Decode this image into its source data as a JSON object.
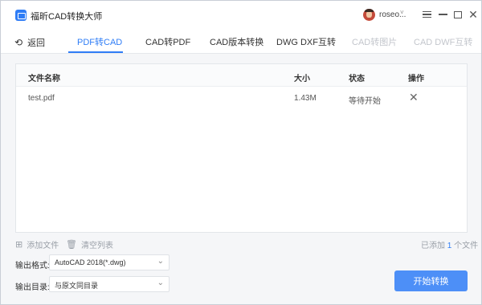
{
  "app": {
    "title": "福昕CAD转换大师",
    "username": "roseo..."
  },
  "tabs": {
    "back_label": "返回",
    "items": [
      {
        "label": "PDF转CAD",
        "state": "active"
      },
      {
        "label": "CAD转PDF",
        "state": "normal"
      },
      {
        "label": "CAD版本转换",
        "state": "normal"
      },
      {
        "label": "DWG DXF互转",
        "state": "normal"
      },
      {
        "label": "CAD转图片",
        "state": "disabled"
      },
      {
        "label": "CAD DWF互转",
        "state": "disabled"
      }
    ]
  },
  "table": {
    "headers": [
      "文件名称",
      "大小",
      "状态",
      "操作"
    ],
    "rows": [
      {
        "name": "test.pdf",
        "size": "1.43M",
        "status": "等待开始"
      }
    ]
  },
  "toolbar": {
    "add_file": "添加文件",
    "clear_list": "清空列表",
    "count_prefix": "已添加",
    "count_value": "1",
    "count_suffix": "个文件"
  },
  "output": {
    "format_label": "输出格式:",
    "format_value": "AutoCAD 2018(*.dwg)",
    "dir_label": "输出目录:",
    "dir_value": "与原文同目录"
  },
  "start_button": "开始转换",
  "colors": {
    "accent": "#2f7df6",
    "button": "#4d8ff7",
    "disabled": "#c3c6cc"
  }
}
